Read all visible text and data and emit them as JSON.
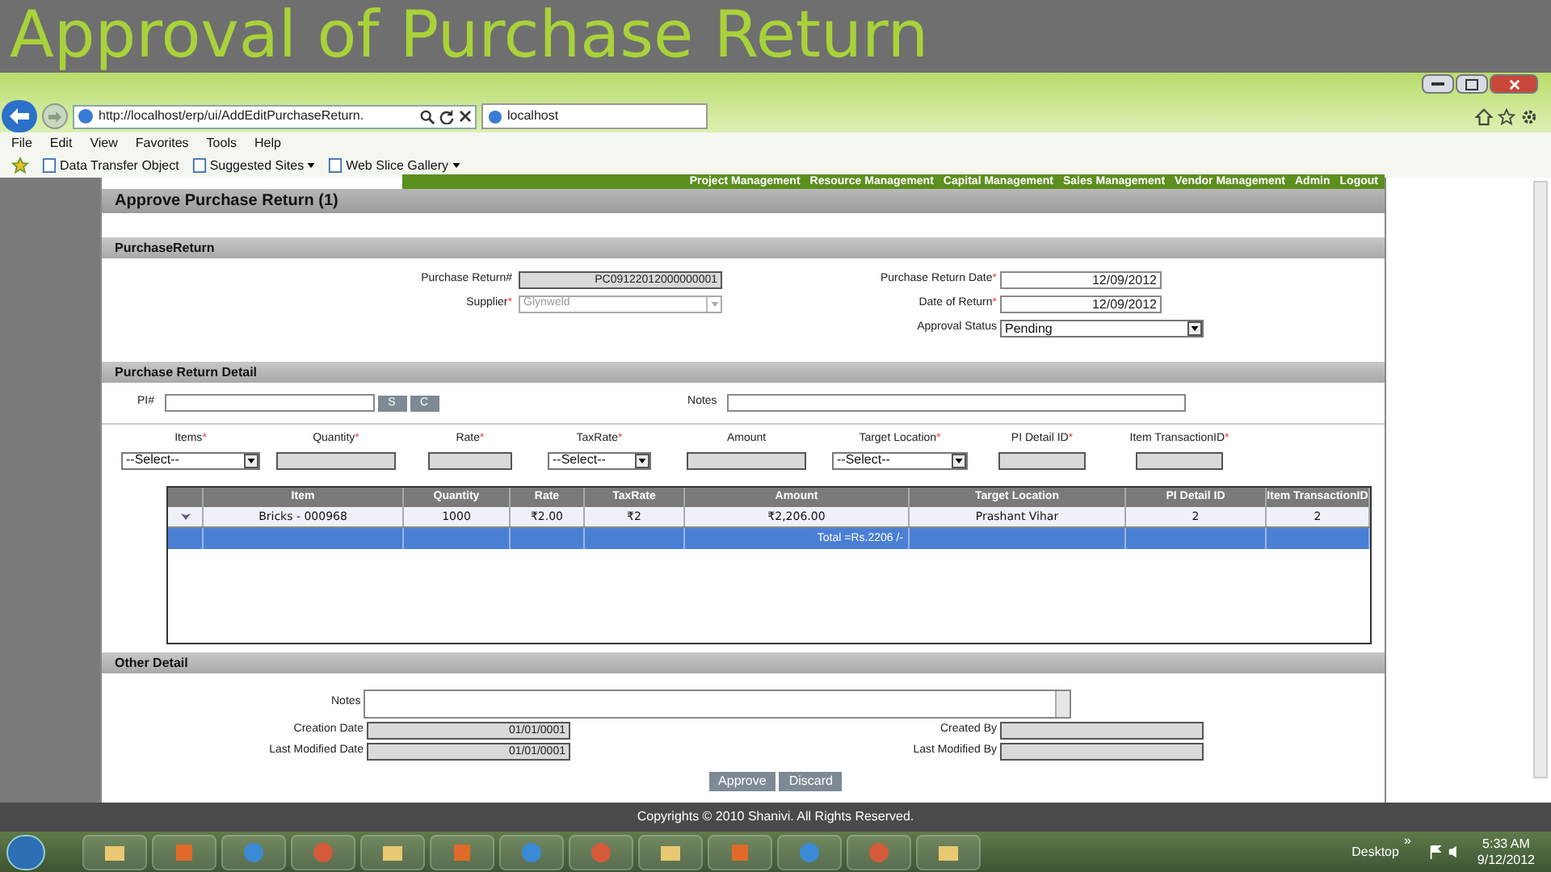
{
  "slide_title": "Approval of Purchase Return",
  "required_mark": "*",
  "browser": {
    "address": "http://localhost/erp/ui/AddEditPurchaseReturn.",
    "tab_title": "localhost",
    "menu": [
      "File",
      "Edit",
      "View",
      "Favorites",
      "Tools",
      "Help"
    ],
    "favorites": [
      {
        "label": "Data Transfer Object",
        "dropdown": false
      },
      {
        "label": "Suggested Sites",
        "dropdown": true
      },
      {
        "label": "Web Slice Gallery",
        "dropdown": true
      }
    ]
  },
  "nav_menu": [
    "Project Management",
    "Resource Management",
    "Capital Management",
    "Sales Management",
    "Vendor Management",
    "Admin",
    "Logout"
  ],
  "page_title": "Approve Purchase Return (1)",
  "purchase_return": {
    "heading": "PurchaseReturn",
    "left_fields": [
      {
        "label": "Purchase Return#",
        "required": false,
        "value": "PC09122012000000001",
        "kind": "readonly"
      },
      {
        "label": "Supplier",
        "required": true,
        "value": "Glynweld",
        "kind": "disabled_select"
      }
    ],
    "right_fields": [
      {
        "label": "Purchase Return Date",
        "required": true,
        "value": "12/09/2012",
        "kind": "text"
      },
      {
        "label": "Date of Return",
        "required": true,
        "value": "12/09/2012",
        "kind": "text"
      },
      {
        "label": "Approval Status",
        "required": false,
        "value": "Pending",
        "kind": "select"
      }
    ]
  },
  "detail": {
    "heading": "Purchase Return Detail",
    "pi_label": "PI#",
    "search_button": "S",
    "clear_button": "C",
    "notes_label": "Notes",
    "entry_fields": [
      {
        "label": "Items",
        "required": true,
        "kind": "select",
        "value": "--Select--"
      },
      {
        "label": "Quantity",
        "required": true,
        "kind": "readonly"
      },
      {
        "label": "Rate",
        "required": true,
        "kind": "readonly"
      },
      {
        "label": "TaxRate",
        "required": true,
        "kind": "select",
        "value": "--Select--"
      },
      {
        "label": "Amount",
        "required": false,
        "kind": "readonly"
      },
      {
        "label": "Target Location",
        "required": true,
        "kind": "select",
        "value": "--Select--"
      },
      {
        "label": "PI Detail ID",
        "required": true,
        "kind": "readonly"
      },
      {
        "label": "Item TransactionID",
        "required": true,
        "kind": "readonly"
      }
    ],
    "table": {
      "columns": [
        "Item",
        "Quantity",
        "Rate",
        "TaxRate",
        "Amount",
        "Target Location",
        "PI Detail ID",
        "Item TransactionID"
      ],
      "rows": [
        {
          "cells": [
            "Bricks - 000968",
            "1000",
            "₹2.00",
            "₹2",
            "₹2,206.00",
            "Prashant Vihar",
            "2",
            "2"
          ]
        }
      ],
      "total": "Total =Rs.2206 /-"
    }
  },
  "other_detail": {
    "heading": "Other Detail",
    "notes_label": "Notes",
    "left_fields": [
      {
        "label": "Creation Date",
        "value": "01/01/0001"
      },
      {
        "label": "Last Modified Date",
        "value": "01/01/0001"
      }
    ],
    "right_fields": [
      {
        "label": "Created By"
      },
      {
        "label": "Last Modified By"
      }
    ]
  },
  "buttons": [
    "Approve",
    "Discard"
  ],
  "footer": "Copyrights © 2010 Shanivi. All Rights Reserved.",
  "taskbar": {
    "toolbar_label": "Desktop",
    "chevron": "»",
    "time": "5:33 AM",
    "date": "9/12/2012"
  }
}
